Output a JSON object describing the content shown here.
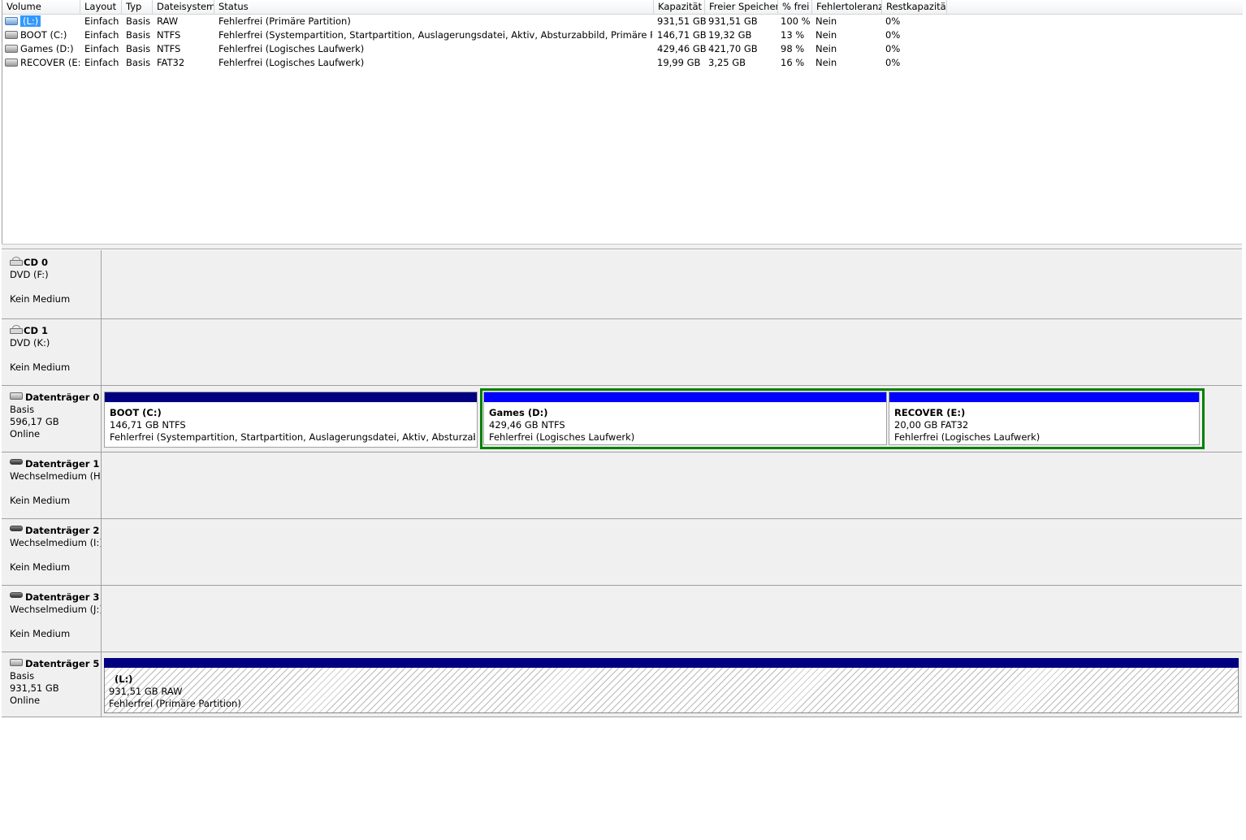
{
  "volume_table": {
    "columns": [
      "Volume",
      "Layout",
      "Typ",
      "Dateisystem",
      "Status",
      "Kapazität",
      "Freier Speicher",
      "% frei",
      "Fehlertoleranz",
      "Restkapazität"
    ],
    "rows": [
      {
        "volume": "(L:)",
        "layout": "Einfach",
        "typ": "Basis",
        "dateisystem": "RAW",
        "status": "Fehlerfrei (Primäre Partition)",
        "kapazitaet": "931,51 GB",
        "frei": "931,51 GB",
        "prozent": "100 %",
        "fehlertoleranz": "Nein",
        "rest": "0%",
        "icon": "blue-disk-icon",
        "selected": true
      },
      {
        "volume": "BOOT (C:)",
        "layout": "Einfach",
        "typ": "Basis",
        "dateisystem": "NTFS",
        "status": "Fehlerfrei (Systempartition, Startpartition, Auslagerungsdatei, Aktiv, Absturzabbild, Primäre Partition)",
        "kapazitaet": "146,71 GB",
        "frei": "19,32 GB",
        "prozent": "13 %",
        "fehlertoleranz": "Nein",
        "rest": "0%",
        "icon": "disk-icon"
      },
      {
        "volume": "Games (D:)",
        "layout": "Einfach",
        "typ": "Basis",
        "dateisystem": "NTFS",
        "status": "Fehlerfrei (Logisches Laufwerk)",
        "kapazitaet": "429,46 GB",
        "frei": "421,70 GB",
        "prozent": "98 %",
        "fehlertoleranz": "Nein",
        "rest": "0%",
        "icon": "disk-icon"
      },
      {
        "volume": "RECOVER (E:)",
        "layout": "Einfach",
        "typ": "Basis",
        "dateisystem": "FAT32",
        "status": "Fehlerfrei (Logisches Laufwerk)",
        "kapazitaet": "19,99 GB",
        "frei": "3,25 GB",
        "prozent": "16 %",
        "fehlertoleranz": "Nein",
        "rest": "0%",
        "icon": "disk-icon"
      }
    ]
  },
  "disks": {
    "cd0": {
      "name": "CD 0",
      "line2": "DVD (F:)",
      "line3": "Kein Medium",
      "icon": "cd-drive-icon"
    },
    "cd1": {
      "name": "CD 1",
      "line2": "DVD (K:)",
      "line3": "Kein Medium",
      "icon": "cd-drive-icon"
    },
    "d0": {
      "name": "Datenträger 0",
      "line2": "Basis",
      "line3": "596,17 GB",
      "line4": "Online",
      "icon": "hard-disk-icon",
      "partitions": [
        {
          "title": "BOOT  (C:)",
          "size": "146,71 GB NTFS",
          "status": "Fehlerfrei (Systempartition, Startpartition, Auslagerungsdatei, Aktiv, Absturzabbild, Pr"
        },
        {
          "title": "Games  (D:)",
          "size": "429,46 GB NTFS",
          "status": "Fehlerfrei (Logisches Laufwerk)"
        },
        {
          "title": "RECOVER  (E:)",
          "size": "20,00 GB FAT32",
          "status": "Fehlerfrei (Logisches Laufwerk)"
        }
      ]
    },
    "d1": {
      "name": "Datenträger 1",
      "line2": "Wechselmedium (H:",
      "line3": "Kein Medium",
      "icon": "removable-disk-icon"
    },
    "d2": {
      "name": "Datenträger 2",
      "line2": "Wechselmedium (I:)",
      "line3": "Kein Medium",
      "icon": "removable-disk-icon"
    },
    "d3": {
      "name": "Datenträger 3",
      "line2": "Wechselmedium (J:)",
      "line3": "Kein Medium",
      "icon": "removable-disk-icon"
    },
    "d5": {
      "name": "Datenträger 5",
      "line2": "Basis",
      "line3": "931,51 GB",
      "line4": "Online",
      "icon": "hard-disk-icon",
      "partitions": [
        {
          "title": "(L:)",
          "size": "931,51 GB RAW",
          "status": "Fehlerfrei (Primäre Partition)"
        }
      ]
    }
  },
  "colors": {
    "primary_partition": "#000080",
    "logical_drive": "#0000ff",
    "extended_partition": "#008000",
    "selection": "#3399ff"
  }
}
